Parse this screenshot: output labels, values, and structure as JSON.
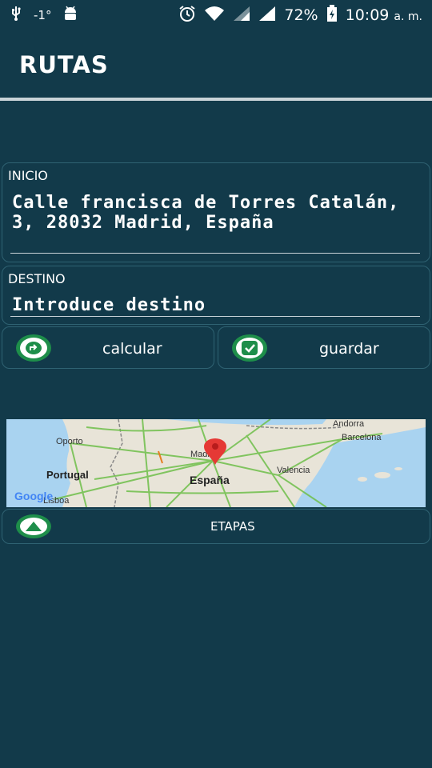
{
  "statusbar": {
    "temperature": "-1°",
    "battery": "72%",
    "time": "10:09",
    "ampm": "a. m."
  },
  "app": {
    "title": "RUTAS"
  },
  "inicio": {
    "label": "INICIO",
    "value": "Calle francisca de Torres Catalán, 3, 28032 Madrid, España"
  },
  "destino": {
    "label": "DESTINO",
    "placeholder": "Introduce destino"
  },
  "buttons": {
    "calcular": "calcular",
    "guardar": "guardar",
    "etapas": "ETAPAS"
  },
  "map": {
    "labels": [
      "Oporto",
      "Portugal",
      "Lisboa",
      "Madrid",
      "España",
      "Valencia",
      "Andorra",
      "Barcelona"
    ],
    "logo": "Google"
  },
  "colors": {
    "background": "#123a4a",
    "accent_green": "#1e8e4a",
    "pin_red": "#e53935"
  }
}
